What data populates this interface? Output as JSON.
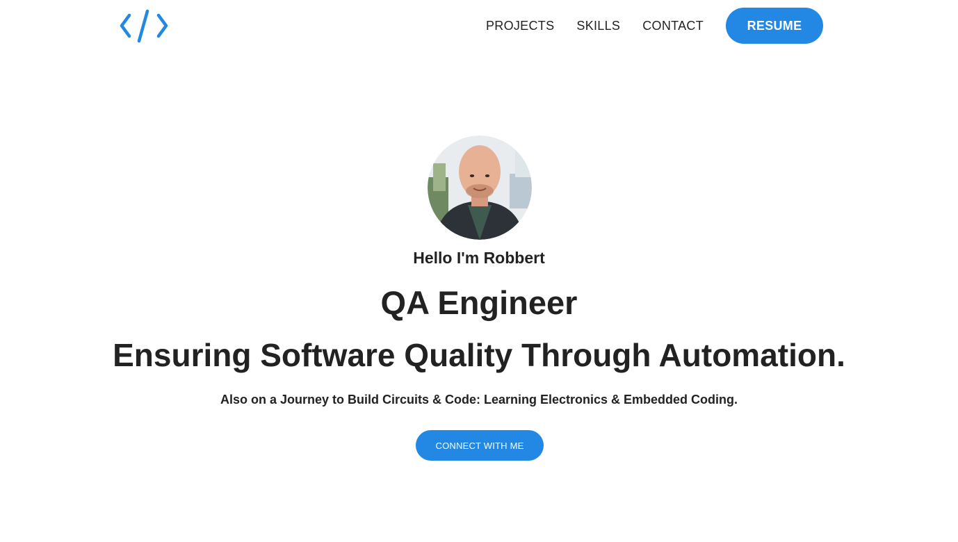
{
  "colors": {
    "accent": "#2388e3",
    "text": "#222222",
    "background": "#ffffff"
  },
  "header": {
    "logo_icon": "code-brackets-icon",
    "nav": [
      {
        "label": "PROJECTS"
      },
      {
        "label": "SKILLS"
      },
      {
        "label": "CONTACT"
      }
    ],
    "resume_label": "RESUME"
  },
  "hero": {
    "avatar_icon": "profile-photo",
    "greeting": "Hello I'm Robbert",
    "role": "QA Engineer",
    "tagline": "Ensuring Software Quality Through Automation.",
    "subline": "Also on a Journey to Build Circuits & Code: Learning Electronics & Embedded Coding.",
    "cta_label": "CONNECT WITH ME"
  }
}
